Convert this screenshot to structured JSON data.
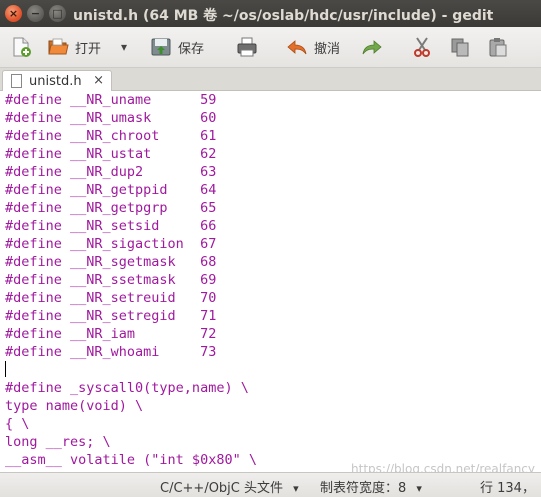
{
  "window": {
    "title": "unistd.h (64 MB 卷 ~/os/oslab/hdc/usr/include) - gedit",
    "close_glyph": "×",
    "minimize_glyph": "−",
    "maximize_glyph": "□"
  },
  "toolbar": {
    "open_label": "打开",
    "save_label": "保存",
    "undo_label": "撤消",
    "icons": [
      "new-document-icon",
      "open-folder-icon",
      "dropdown-arrow-icon",
      "save-icon",
      "print-icon",
      "undo-icon",
      "redo-icon",
      "cut-icon",
      "copy-icon",
      "paste-icon"
    ],
    "dropdown_glyph": "▾"
  },
  "tabs": [
    {
      "label": "unistd.h",
      "close_glyph": "×"
    }
  ],
  "editor": {
    "lines": [
      "#define __NR_uname      59",
      "#define __NR_umask      60",
      "#define __NR_chroot     61",
      "#define __NR_ustat      62",
      "#define __NR_dup2       63",
      "#define __NR_getppid    64",
      "#define __NR_getpgrp    65",
      "#define __NR_setsid     66",
      "#define __NR_sigaction  67",
      "#define __NR_sgetmask   68",
      "#define __NR_ssetmask   69",
      "#define __NR_setreuid   70",
      "#define __NR_setregid   71",
      "#define __NR_iam        72",
      "#define __NR_whoami     73",
      "",
      "#define _syscall0(type,name) \\",
      "type name(void) \\",
      "{ \\",
      "long __res; \\",
      "__asm__ volatile (\"int $0x80\" \\"
    ],
    "text_color": "#a0199f"
  },
  "statusbar": {
    "language": "C/C++/ObjC 头文件",
    "tab_width": "制表符宽度：8",
    "position": "行 134，",
    "dropdown_glyph": "▾"
  },
  "watermark": "https://blog.csdn.net/realfancy"
}
